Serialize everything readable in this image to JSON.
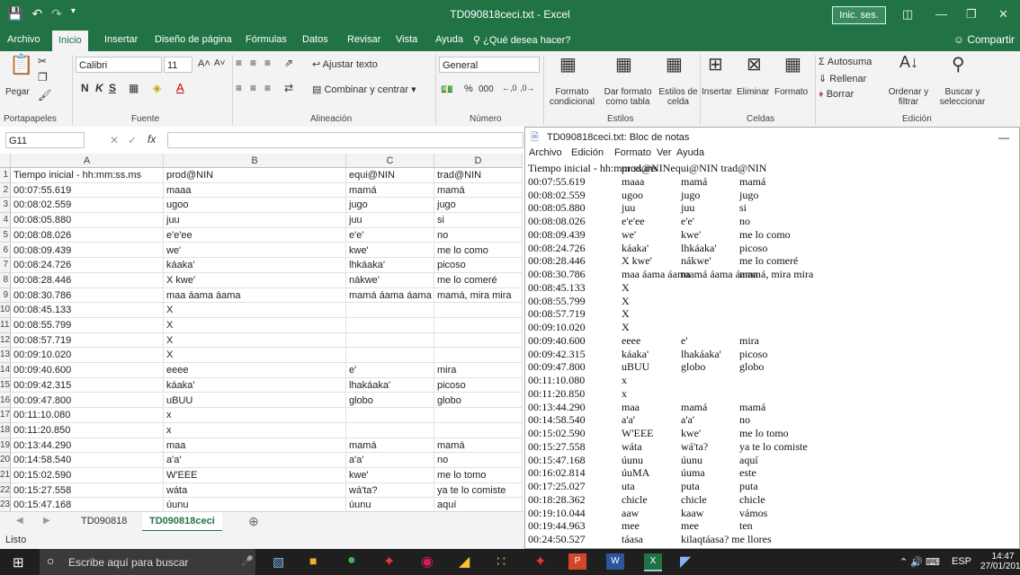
{
  "window": {
    "title": "TD090818ceci.txt  -  Excel",
    "signin": "Inic. ses."
  },
  "tabs": [
    "Archivo",
    "Inicio",
    "Insertar",
    "Diseño de página",
    "Fórmulas",
    "Datos",
    "Revisar",
    "Vista",
    "Ayuda"
  ],
  "tell_me": "¿Qué desea hacer?",
  "share": "Compartir",
  "ribbon": {
    "paste": "Pegar",
    "font_name": "Calibri",
    "font_size": "11",
    "wrap_text": "Ajustar texto",
    "merge_center": "Combinar y centrar",
    "number_format": "General",
    "percent": "%",
    "thousands": "000",
    "conditional_format": [
      "Formato",
      "condicional"
    ],
    "format_table": [
      "Dar formato",
      "como tabla"
    ],
    "cell_styles": [
      "Estilos de",
      "celda"
    ],
    "insert": "Insertar",
    "delete": "Eliminar",
    "format": "Formato",
    "autosum": "Autosuma",
    "fill": "Rellenar",
    "clear": "Borrar",
    "sort_filter": [
      "Ordenar y",
      "filtrar"
    ],
    "find_select": [
      "Buscar y",
      "seleccionar"
    ],
    "groups": [
      "Portapapeles",
      "Fuente",
      "Alineación",
      "Número",
      "Estilos",
      "Celdas",
      "Edición"
    ]
  },
  "formula_bar": {
    "name_box": "G11",
    "fx": "fx"
  },
  "grid": {
    "columns": [
      "A",
      "B",
      "C",
      "D"
    ],
    "rows": [
      [
        "Tiempo inicial - hh:mm:ss.ms",
        "prod@NIN",
        "equi@NIN",
        "trad@NIN"
      ],
      [
        "00:07:55.619",
        "maaa",
        "mamá",
        "mamá"
      ],
      [
        "00:08:02.559",
        "ugoo",
        "jugo",
        "jugo"
      ],
      [
        "00:08:05.880",
        "juu",
        "juu",
        "si"
      ],
      [
        "00:08:08.026",
        "e'e'ee",
        "e'e'",
        "no"
      ],
      [
        "00:08:09.439",
        "we'",
        "kwe'",
        "me lo como"
      ],
      [
        "00:08:24.726",
        "káaka'",
        "lhkáaka'",
        "picoso"
      ],
      [
        "00:08:28.446",
        "X kwe'",
        "nákwe'",
        "me lo comeré"
      ],
      [
        "00:08:30.786",
        "maa áama áama",
        "mamá áama áama",
        "mamá, mira mira"
      ],
      [
        "00:08:45.133",
        "X",
        "",
        ""
      ],
      [
        "00:08:55.799",
        "X",
        "",
        ""
      ],
      [
        "00:08:57.719",
        "X",
        "",
        ""
      ],
      [
        "00:09:10.020",
        "X",
        "",
        ""
      ],
      [
        "00:09:40.600",
        "eeee",
        "e'",
        "mira"
      ],
      [
        "00:09:42.315",
        "káaka'",
        "lhakáaka'",
        "picoso"
      ],
      [
        "00:09:47.800",
        "uBUU",
        "globo",
        "globo"
      ],
      [
        "00:11:10.080",
        "x",
        "",
        ""
      ],
      [
        "00:11:20.850",
        "x",
        "",
        ""
      ],
      [
        "00:13:44.290",
        "maa",
        "mamá",
        "mamá"
      ],
      [
        "00:14:58.540",
        "a'a'",
        "a'a'",
        "no"
      ],
      [
        "00:15:02.590",
        "W'EEE",
        "kwe'",
        "me lo tomo"
      ],
      [
        "00:15:27.558",
        "wáta",
        "wá'ta?",
        "ya te lo comiste"
      ],
      [
        "00:15:47.168",
        "úunu",
        "úunu",
        "aquí"
      ]
    ]
  },
  "sheets": [
    "TD090818",
    "TD090818ceci"
  ],
  "status": "Listo",
  "notepad": {
    "title": "TD090818ceci.txt: Bloc de notas",
    "menu": [
      "Archivo",
      "Edición",
      "Formato",
      "Ver",
      "Ayuda"
    ],
    "lines": [
      [
        "Tiempo inicial - hh:mm:ss.ms",
        "prod@NINequi@NIN trad@NIN",
        "",
        ""
      ],
      [
        "00:07:55.619",
        "maaa",
        "mamá",
        "mamá"
      ],
      [
        "00:08:02.559",
        "ugoo",
        "jugo",
        "jugo"
      ],
      [
        "00:08:05.880",
        "juu",
        "juu",
        "si"
      ],
      [
        "00:08:08.026",
        "e'e'ee",
        "e'e'",
        "no"
      ],
      [
        "00:08:09.439",
        "we'",
        "kwe'",
        "me lo como"
      ],
      [
        "00:08:24.726",
        "káaka'",
        "lhkáaka'",
        "picoso"
      ],
      [
        "00:08:28.446",
        "X kwe'",
        "nákwe'",
        "me lo comeré"
      ],
      [
        "00:08:30.786",
        "maa áama áama",
        "mamá áama áama",
        "mamá, mira mira"
      ],
      [
        "00:08:45.133",
        "X",
        "",
        ""
      ],
      [
        "00:08:55.799",
        "X",
        "",
        ""
      ],
      [
        "00:08:57.719",
        "X",
        "",
        ""
      ],
      [
        "00:09:10.020",
        "X",
        "",
        ""
      ],
      [
        "00:09:40.600",
        "eeee",
        "e'",
        "mira"
      ],
      [
        "00:09:42.315",
        "káaka'",
        "lhakáaka'",
        "picoso"
      ],
      [
        "00:09:47.800",
        "uBUU",
        "globo",
        "globo"
      ],
      [
        "00:11:10.080",
        "x",
        "",
        ""
      ],
      [
        "00:11:20.850",
        "x",
        "",
        ""
      ],
      [
        "00:13:44.290",
        "maa",
        "mamá",
        "mamá"
      ],
      [
        "00:14:58.540",
        "a'a'",
        "a'a'",
        "no"
      ],
      [
        "00:15:02.590",
        "W'EEE",
        "kwe'",
        "me lo tomo"
      ],
      [
        "00:15:27.558",
        "wáta",
        "wá'ta?",
        "ya te lo comiste"
      ],
      [
        "00:15:47.168",
        "úunu",
        "úunu",
        "aquí"
      ],
      [
        "00:16:02.814",
        "úuMA",
        "úuma",
        "este"
      ],
      [
        "00:17:25.027",
        "uta",
        "puta",
        "puta"
      ],
      [
        "00:18:28.362",
        "chicle",
        "chicle",
        "chicle"
      ],
      [
        "00:19:10.044",
        "aaw",
        "kaaw",
        "vámos"
      ],
      [
        "00:19:44.963",
        "mee",
        "mee",
        "ten"
      ],
      [
        "00:24:50.527",
        "táasa",
        "kilaqtáasa? me llores",
        ""
      ]
    ]
  },
  "taskbar": {
    "search_placeholder": "Escribe aquí para buscar",
    "lang": "ESP",
    "time": "14:47",
    "date": "27/01/2019"
  },
  "colors": {
    "excel_green": "#217346",
    "taskbar": "#1f1f1f"
  }
}
